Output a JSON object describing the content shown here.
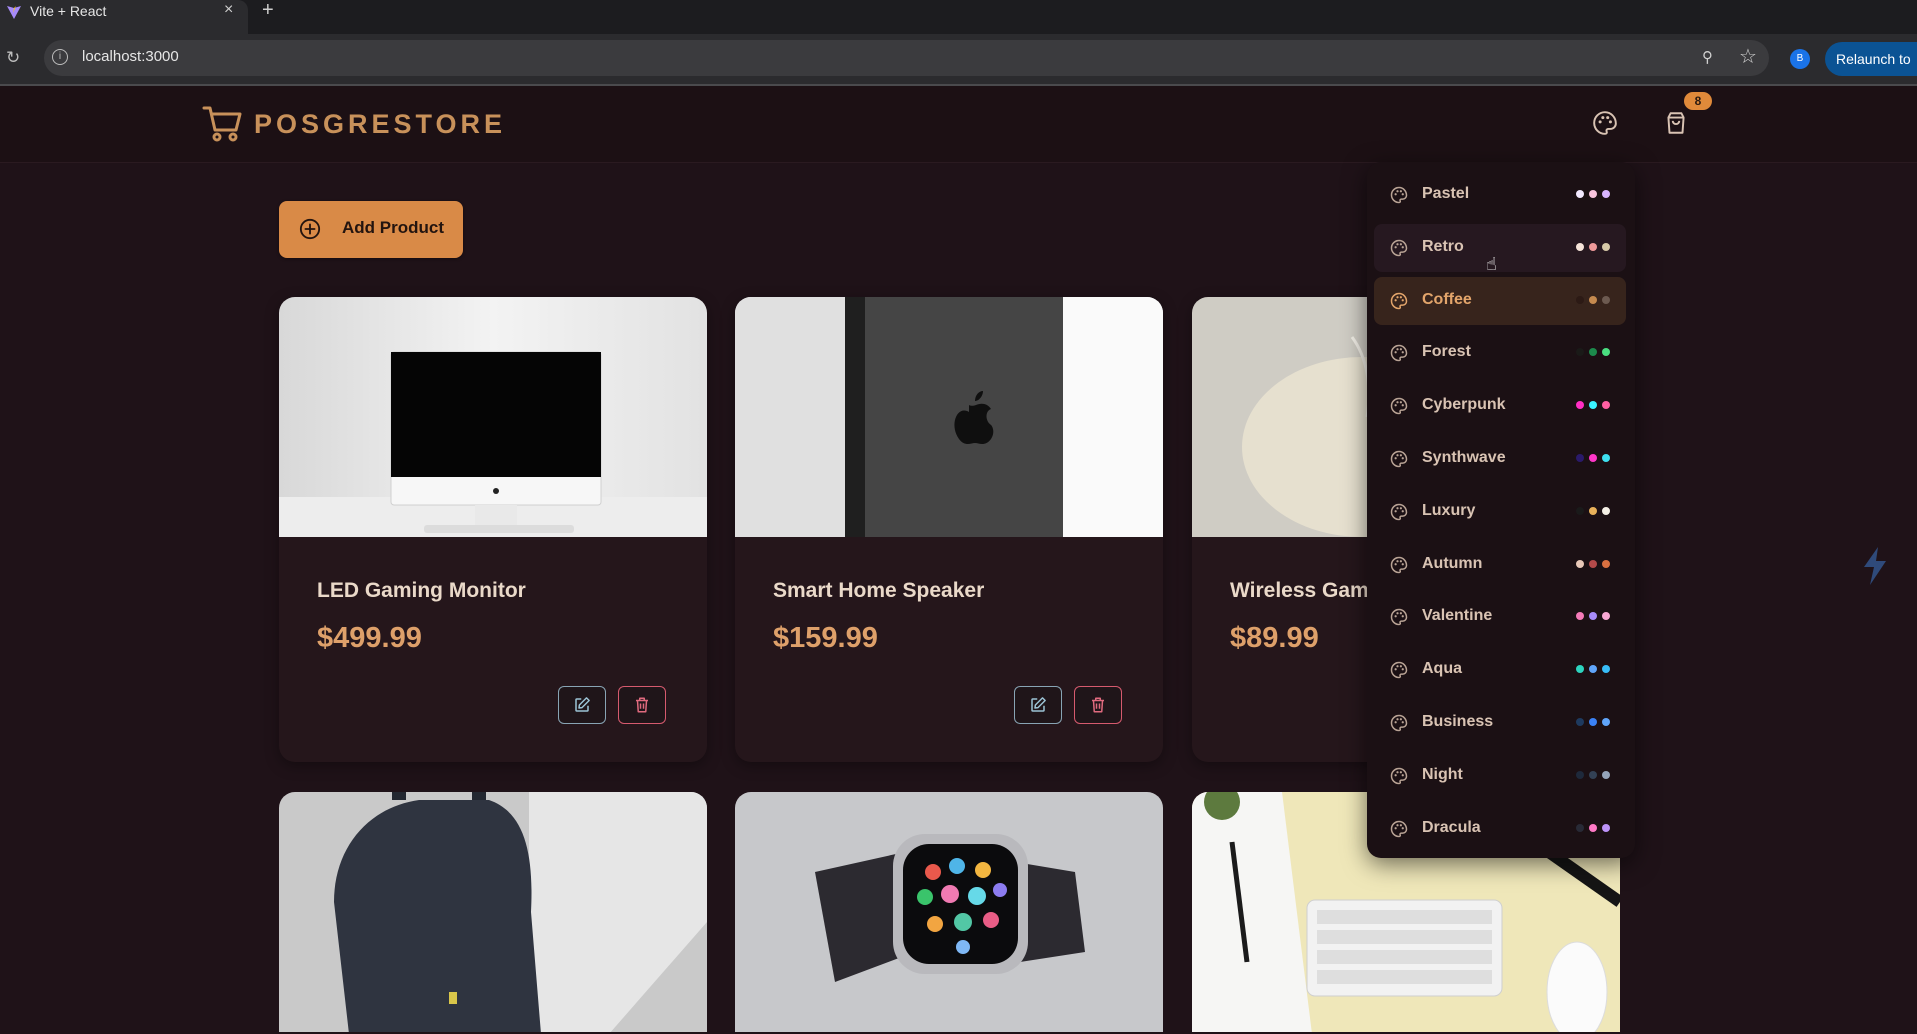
{
  "browser": {
    "tab_title": "Vite + React",
    "tab_close": "×",
    "new_tab": "+",
    "url": "localhost:3000",
    "profile_initial": "B",
    "relaunch_label": "Relaunch to"
  },
  "navbar": {
    "brand": "POSGRESTORE",
    "cart_count": "8"
  },
  "main": {
    "add_product_label": "Add Product"
  },
  "products": [
    {
      "name": "LED Gaming Monitor",
      "price": "$499.99",
      "icon": "monitor"
    },
    {
      "name": "Smart Home Speaker",
      "price": "$159.99",
      "icon": "speaker"
    },
    {
      "name": "Wireless Gaming Mouse",
      "price": "$89.99",
      "icon": "mouse"
    }
  ],
  "products_row2": [
    {
      "icon": "backpack"
    },
    {
      "icon": "smartwatch"
    },
    {
      "icon": "keyboard"
    }
  ],
  "themes": [
    {
      "label": "Pastel",
      "colors": [
        "#f3e9ff",
        "#f9c4dd",
        "#d8b4fe"
      ]
    },
    {
      "label": "Retro",
      "colors": [
        "#f6e4d9",
        "#ef9a9a",
        "#d7c9a8"
      ]
    },
    {
      "label": "Coffee",
      "colors": [
        "#2c1a15",
        "#c58a4f",
        "#6c5a50"
      ]
    },
    {
      "label": "Forest",
      "colors": [
        "#1a1a18",
        "#1c8a4c",
        "#4ade80"
      ]
    },
    {
      "label": "Cyberpunk",
      "colors": [
        "#ff2ec4",
        "#3af3ff",
        "#ff5fa2"
      ]
    },
    {
      "label": "Synthwave",
      "colors": [
        "#2a1a6a",
        "#ff36c8",
        "#3ee0f0"
      ]
    },
    {
      "label": "Luxury",
      "colors": [
        "#1a1a1a",
        "#e8b15a",
        "#f5f0e6"
      ]
    },
    {
      "label": "Autumn",
      "colors": [
        "#e8c8b8",
        "#b44a4a",
        "#d97041"
      ]
    },
    {
      "label": "Valentine",
      "colors": [
        "#f47ab8",
        "#a78bfa",
        "#f9a8d4"
      ]
    },
    {
      "label": "Aqua",
      "colors": [
        "#2dd4bf",
        "#60a5fa",
        "#38bdf8"
      ]
    },
    {
      "label": "Business",
      "colors": [
        "#1e3a5f",
        "#3b82f6",
        "#60a5fa"
      ]
    },
    {
      "label": "Night",
      "colors": [
        "#1e293b",
        "#334155",
        "#94a3b8"
      ]
    },
    {
      "label": "Dracula",
      "colors": [
        "#282a36",
        "#ff79c6",
        "#bd93f9"
      ]
    }
  ],
  "colors": {
    "background": "#1f1218",
    "accent": "#d98a47",
    "price": "#dea06a"
  }
}
